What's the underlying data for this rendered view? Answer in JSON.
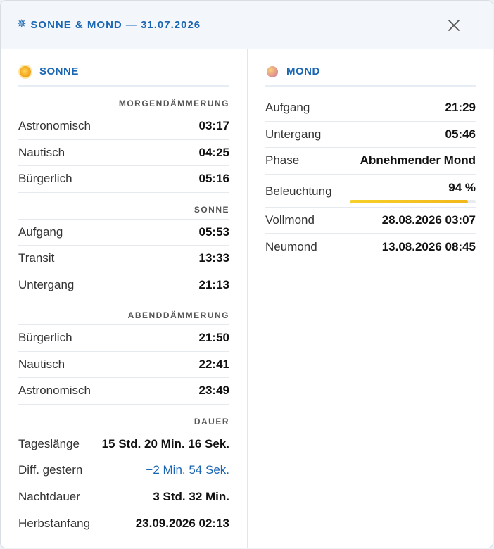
{
  "header": {
    "icon": "sun-burst-icon",
    "title": "SONNE & MOND — 31.07.2026",
    "close_icon": "close-icon"
  },
  "sun": {
    "title": "SONNE",
    "groups": [
      {
        "heading": "MORGENDÄMMERUNG",
        "rows": [
          {
            "label": "Astronomisch",
            "value": "03:17"
          },
          {
            "label": "Nautisch",
            "value": "04:25"
          },
          {
            "label": "Bürgerlich",
            "value": "05:16"
          }
        ]
      },
      {
        "heading": "SONNE",
        "rows": [
          {
            "label": "Aufgang",
            "value": "05:53"
          },
          {
            "label": "Transit",
            "value": "13:33"
          },
          {
            "label": "Untergang",
            "value": "21:13"
          }
        ]
      },
      {
        "heading": "ABENDDÄMMERUNG",
        "rows": [
          {
            "label": "Bürgerlich",
            "value": "21:50"
          },
          {
            "label": "Nautisch",
            "value": "22:41"
          },
          {
            "label": "Astronomisch",
            "value": "23:49"
          }
        ]
      },
      {
        "heading": "DAUER",
        "rows": [
          {
            "label": "Tageslänge",
            "value": "15 Std. 20 Min. 16 Sek."
          },
          {
            "label": "Diff. gestern",
            "value": "−2 Min. 54 Sek."
          },
          {
            "label": "Nachtdauer",
            "value": "3 Std. 32 Min."
          },
          {
            "label": "Herbstanfang",
            "value": "23.09.2026 02:13"
          }
        ]
      }
    ]
  },
  "moon": {
    "title": "MOND",
    "rows": [
      {
        "label": "Aufgang",
        "value": "21:29"
      },
      {
        "label": "Untergang",
        "value": "05:46"
      },
      {
        "label": "Phase",
        "value": "Abnehmender Mond"
      }
    ],
    "illumination": {
      "label": "Beleuchtung",
      "value": "94 %",
      "fraction": 0.94
    },
    "rows_after": [
      {
        "label": "Vollmond",
        "value": "28.08.2026 03:07"
      },
      {
        "label": "Neumond",
        "value": "13.08.2026 08:45"
      }
    ]
  },
  "colors": {
    "accent": "#1a66b3",
    "illumination_bar": "#f2b81b"
  }
}
